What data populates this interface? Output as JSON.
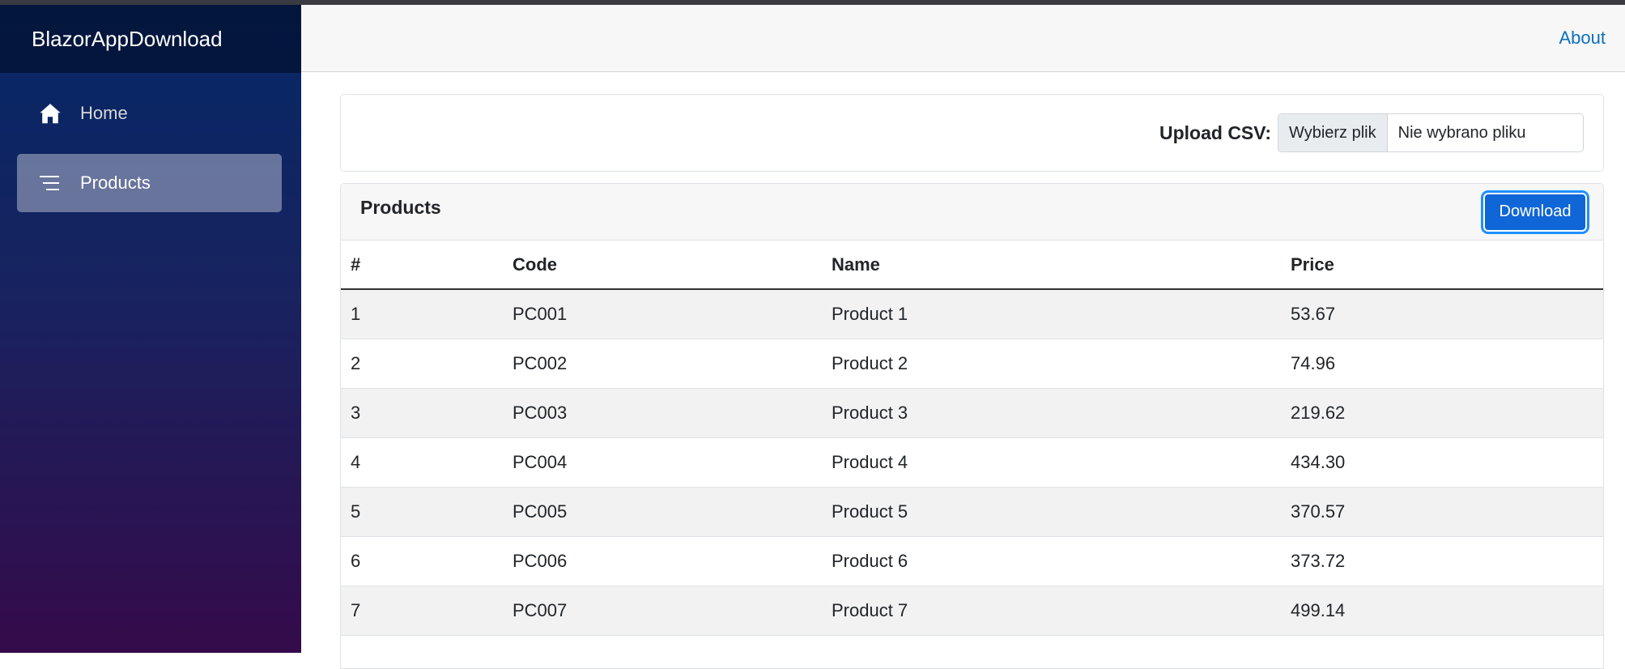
{
  "sidebar": {
    "brand": "BlazorAppDownload",
    "items": [
      {
        "label": "Home",
        "icon": "home-icon",
        "active": false
      },
      {
        "label": "Products",
        "icon": "list-icon",
        "active": true
      }
    ]
  },
  "header": {
    "about_label": "About"
  },
  "upload": {
    "label": "Upload CSV:",
    "button_label": "Wybierz plik",
    "status_text": "Nie wybrano pliku"
  },
  "products_card": {
    "title": "Products",
    "download_label": "Download",
    "columns": [
      "#",
      "Code",
      "Name",
      "Price"
    ],
    "rows": [
      [
        "1",
        "PC001",
        "Product 1",
        "53.67"
      ],
      [
        "2",
        "PC002",
        "Product 2",
        "74.96"
      ],
      [
        "3",
        "PC003",
        "Product 3",
        "219.62"
      ],
      [
        "4",
        "PC004",
        "Product 4",
        "434.30"
      ],
      [
        "5",
        "PC005",
        "Product 5",
        "370.57"
      ],
      [
        "6",
        "PC006",
        "Product 6",
        "373.72"
      ],
      [
        "7",
        "PC007",
        "Product 7",
        "499.14"
      ]
    ]
  },
  "colors": {
    "accent": "#1066d6",
    "link": "#0d6ebd",
    "sidebar_top": "#052767",
    "sidebar_bottom": "#3a0647"
  }
}
